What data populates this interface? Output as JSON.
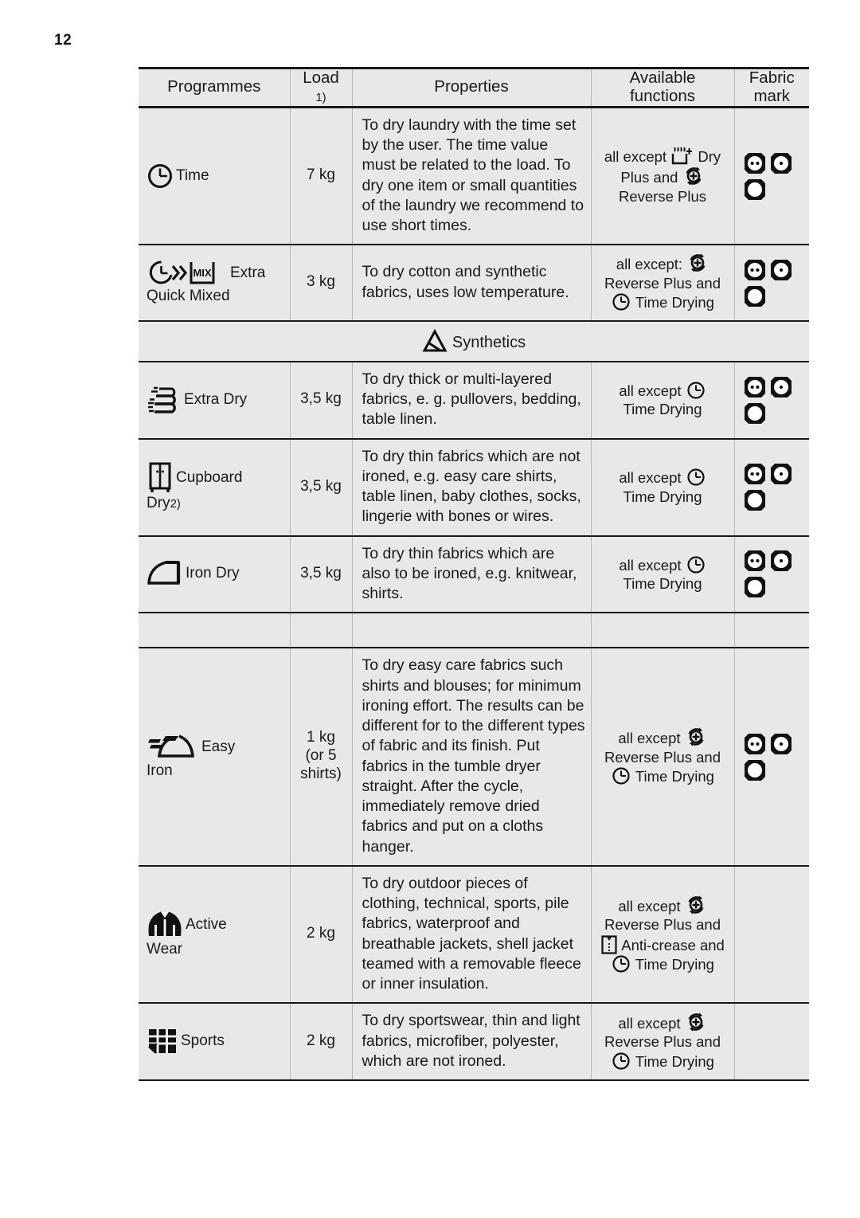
{
  "page": {
    "number": "12"
  },
  "table": {
    "headers": {
      "programmes": "Programmes",
      "load": "Load",
      "load_footnote": "1)",
      "properties": "Properties",
      "available_functions_line1": "Available",
      "available_functions_line2": "functions",
      "fabric_mark_line1": "Fabric",
      "fabric_mark_line2": "mark"
    },
    "rows": [
      {
        "icon": "clock-icon",
        "name": "Time",
        "name_line2": "",
        "footnote": "",
        "load": "7 kg",
        "load_line2": "",
        "load_line3": "",
        "properties": "To dry laundry with the time set by the user. The time value must be related to the load. To dry one item or small quantities of the laundry we recommend to use short times.",
        "func_pre": "all except",
        "func_icon1": "dry-plus-icon",
        "func_mid": "Dry Plus and",
        "func_icon2": "reverse-plus-icon",
        "func_post": "Reverse Plus",
        "fabric_marks": [
          "two-dots",
          "one-dot",
          "no-dot"
        ]
      },
      {
        "icon": "quick-mix-icon",
        "name": "Extra",
        "name_line2": "Quick Mixed",
        "footnote": "",
        "load": "3 kg",
        "load_line2": "",
        "load_line3": "",
        "properties": "To dry cotton and synthetic fabrics, uses low temperature.",
        "func_pre": "all except:",
        "func_icon1": "reverse-plus-icon",
        "func_mid": "Reverse Plus and",
        "func_icon2": "clock-icon",
        "func_post": "Time Drying",
        "fabric_marks": [
          "two-dots",
          "one-dot",
          "no-dot"
        ]
      }
    ],
    "section": {
      "icon": "synthetics-icon",
      "label": "Synthetics"
    },
    "rows2": [
      {
        "icon": "stacked-laundry-icon",
        "name": "Extra Dry",
        "name_line2": "",
        "footnote": "",
        "load": "3,5 kg",
        "properties": "To dry thick or multi-layered fabrics, e. g. pullovers, bedding, table linen.",
        "func_pre": "all except",
        "func_icon1": "clock-icon",
        "func_post": "Time Drying",
        "fabric_marks": [
          "two-dots",
          "one-dot",
          "no-dot"
        ]
      },
      {
        "icon": "cupboard-icon",
        "name": "Cupboard",
        "name_line2": "Dry",
        "footnote": "2)",
        "load": "3,5 kg",
        "properties": "To dry thin fabrics which are not ironed, e.g. easy care shirts, table linen, baby clothes, socks, lingerie with bones or wires.",
        "func_pre": "all except",
        "func_icon1": "clock-icon",
        "func_post": "Time Drying",
        "fabric_marks": [
          "two-dots",
          "one-dot",
          "no-dot"
        ]
      },
      {
        "icon": "iron-icon",
        "name": "Iron Dry",
        "name_line2": "",
        "footnote": "",
        "load": "3,5 kg",
        "properties": "To dry thin fabrics which are also to be ironed, e.g. knitwear, shirts.",
        "func_pre": "all except",
        "func_icon1": "clock-icon",
        "func_post": "Time Drying",
        "fabric_marks": [
          "two-dots",
          "one-dot",
          "no-dot"
        ]
      }
    ],
    "rows3": [
      {
        "icon": "easy-iron-icon",
        "name": "Easy",
        "name_line2": "Iron",
        "footnote": "",
        "load": "1 kg",
        "load_line2": "(or 5",
        "load_line3": "shirts)",
        "properties": "To dry easy care fabrics such shirts and blouses; for minimum ironing effort. The results can be different for to the different types of fabric and its finish. Put fabrics in the tumble dryer straight. After the cycle, immediately remove dried fabrics and put on a cloths hanger.",
        "func_pre": "all except",
        "func_icon1": "reverse-plus-icon",
        "func_mid": "Reverse Plus and",
        "func_icon2": "clock-icon",
        "func_post": "Time Drying",
        "fabric_marks": [
          "two-dots",
          "one-dot",
          "no-dot"
        ]
      },
      {
        "icon": "jacket-icon",
        "name": "Active",
        "name_line2": "Wear",
        "footnote": "",
        "load": "2 kg",
        "properties": "To dry outdoor pieces of clothing, technical, sports, pile fabrics, waterproof and breathable jackets, shell jacket teamed with a removable fleece or inner insulation.",
        "func_pre": "all except",
        "func_icon1": "reverse-plus-icon",
        "func_mid": "Reverse Plus and",
        "func_icon2": "anti-crease-shirt-icon",
        "func_mid2": "Anti-crease and",
        "func_icon3": "clock-icon",
        "func_post": "Time Drying",
        "fabric_marks": []
      },
      {
        "icon": "mesh-grid-icon",
        "name": "Sports",
        "name_line2": "",
        "footnote": "",
        "load": "2 kg",
        "properties": "To dry sportswear, thin and light fabrics, microfiber, polyester, which are not ironed.",
        "func_pre": "all except",
        "func_icon1": "reverse-plus-icon",
        "func_mid": "Reverse Plus and",
        "func_icon2": "clock-icon",
        "func_post": "Time Drying",
        "fabric_marks": []
      }
    ]
  },
  "colors": {
    "cell_background": "#e8e8e8",
    "rule": "#1a1a1a",
    "text": "#1a1a1a",
    "page_background": "#ffffff"
  }
}
